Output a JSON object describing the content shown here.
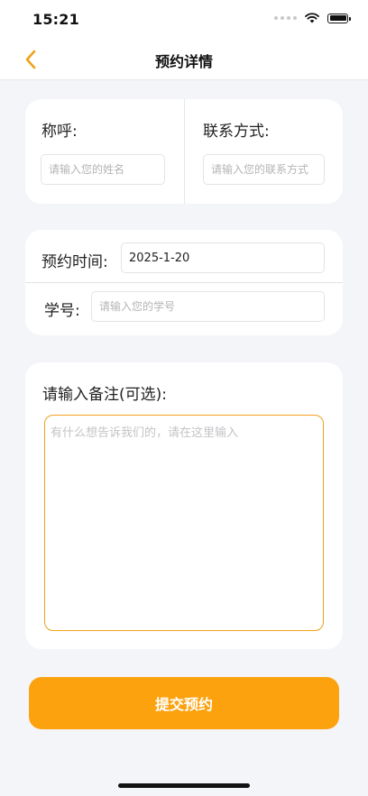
{
  "status_bar": {
    "time": "15:21"
  },
  "nav": {
    "title": "预约详情",
    "back_icon": "chevron-left-icon",
    "accent": "#f2a01b"
  },
  "contact_card": {
    "name_label": "称呼:",
    "name_placeholder": "请输入您的姓名",
    "contact_label": "联系方式:",
    "contact_placeholder": "请输入您的联系方式"
  },
  "booking_card": {
    "time_label": "预约时间:",
    "time_value": "2025-1-20",
    "student_label": "学号:",
    "student_placeholder": "请输入您的学号"
  },
  "notes_card": {
    "label": "请输入备注(可选):",
    "placeholder": "有什么想告诉我们的，请在这里输入"
  },
  "submit": {
    "label": "提交预约",
    "color": "#fca20f"
  }
}
